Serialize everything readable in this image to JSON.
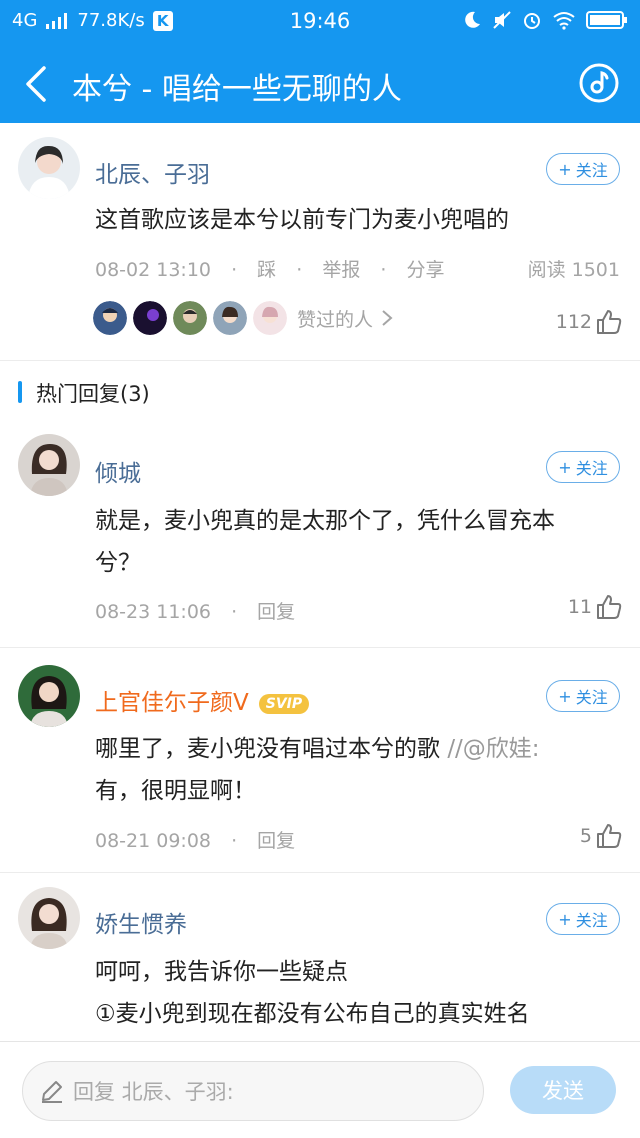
{
  "status_bar": {
    "network": "4G",
    "speed": "77.8K/s",
    "k_badge": "K",
    "time": "19:46"
  },
  "nav": {
    "title": "本兮 - 唱给一些无聊的人"
  },
  "post": {
    "author": "北辰、子羽",
    "follow_label": "关注",
    "text": "这首歌应该是本兮以前专门为麦小兜唱的",
    "date": "08-02 13:10",
    "actions": [
      "踩",
      "举报",
      "分享"
    ],
    "reads": "阅读 1501",
    "likers_label": "赞过的人",
    "like_count": "112"
  },
  "hot_replies": {
    "title": "热门回复(3)"
  },
  "replies": [
    {
      "author": "倾城",
      "follow_label": "关注",
      "text": "就是，麦小兜真的是太那个了，凭什么冒充本兮？",
      "date": "08-23 11:06",
      "reply_label": "回复",
      "like_count": "11"
    },
    {
      "author": "上官佳尓子颜V",
      "badge": "SVIP",
      "follow_label": "关注",
      "text": "哪里了，麦小兜没有唱过本兮的歌 ",
      "quote": "//@欣娃:",
      "text2": "有，很明显啊！",
      "date": "08-21 09:08",
      "reply_label": "回复",
      "like_count": "5"
    },
    {
      "author": "娇生惯养",
      "follow_label": "关注",
      "text_line1": "呵呵，我告诉你一些疑点",
      "text_line2": "①麦小兜到现在都没有公布自己的真实姓名"
    }
  ],
  "composer": {
    "placeholder": "回复 北辰、子羽:",
    "send_label": "发送"
  },
  "colors": {
    "brand_blue": "#1597f0",
    "name_blue": "#4a6d96",
    "vip_orange": "#f06a1d",
    "svip_gold": "#f4c23f"
  }
}
